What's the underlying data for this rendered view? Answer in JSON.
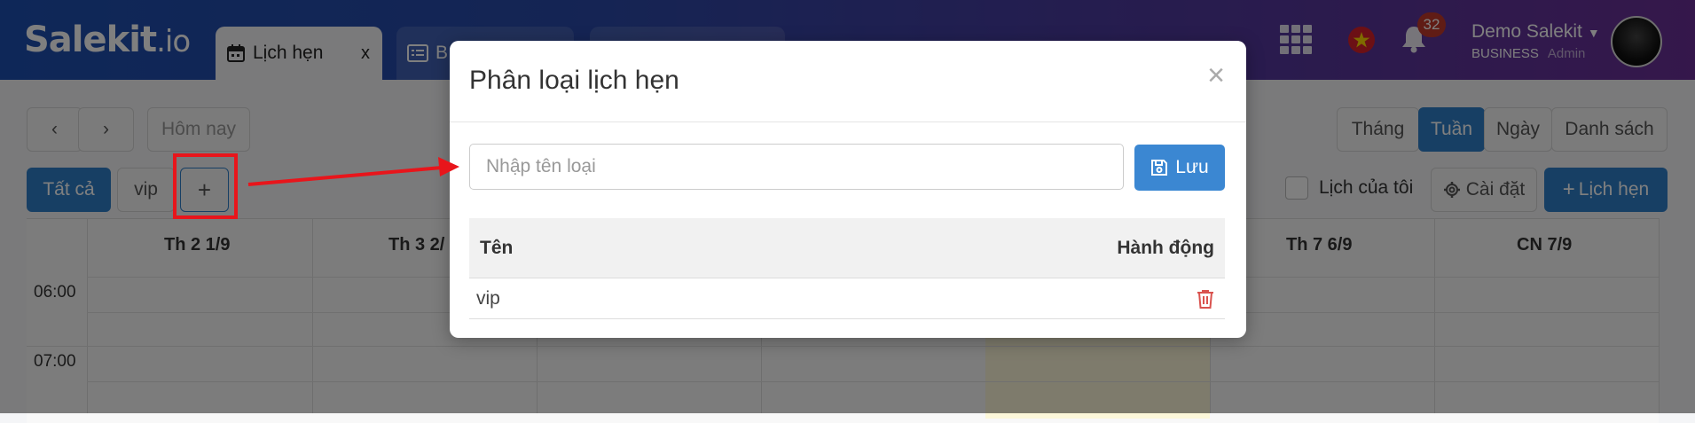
{
  "header": {
    "logo_main": "Salekit",
    "logo_suffix": ".io",
    "tabs": [
      {
        "label": "Lịch hẹn",
        "close": "x",
        "icon": "calendar-icon"
      },
      {
        "label": "B",
        "icon": "list-icon"
      },
      {
        "label": "",
        "icon": ""
      }
    ],
    "notification_count": "32",
    "user_name": "Demo Salekit",
    "user_plan": "BUSINESS",
    "user_role": "Admin"
  },
  "toolbar": {
    "prev": "‹",
    "next": "›",
    "today": "Hôm nay",
    "views": [
      "Tháng",
      "Tuần",
      "Ngày",
      "Danh sách"
    ],
    "active_view": "Tuần",
    "filter_all": "Tất cả",
    "filter_vip": "vip",
    "add_category": "+",
    "my_calendar": "Lịch của tôi",
    "settings": "Cài đặt",
    "new_appointment": "Lịch hẹn"
  },
  "calendar": {
    "days": [
      "Th 2 1/9",
      "Th 3 2/",
      "Th 7 6/9",
      "CN 7/9"
    ],
    "times": [
      "06:00",
      "07:00"
    ]
  },
  "modal": {
    "title": "Phân loại lịch hẹn",
    "close": "×",
    "input_placeholder": "Nhập tên loại",
    "save_label": "Lưu",
    "table": {
      "headers": [
        "Tên",
        "Hành động"
      ],
      "rows": [
        {
          "name": "vip"
        }
      ]
    }
  },
  "colors": {
    "primary": "#2f7fc9",
    "delete": "#d9534f",
    "annotation": "#e8151b"
  }
}
